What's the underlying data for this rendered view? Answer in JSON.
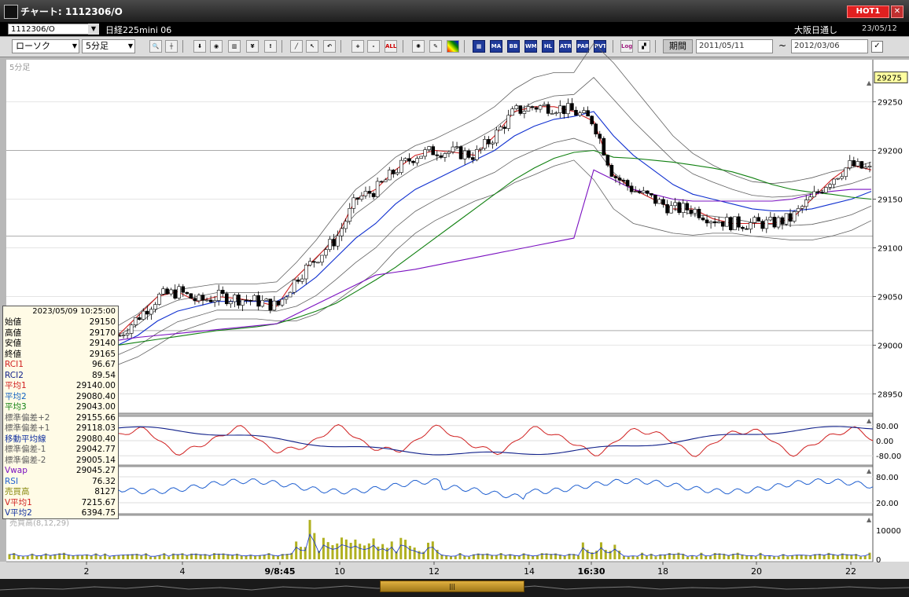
{
  "window": {
    "title": "チャート: 1112306/O",
    "hot_badge": "HOT1",
    "close": "✕"
  },
  "symbol": {
    "code": "1112306/O",
    "name": "日経225mini 06",
    "market": "大阪日通し",
    "date": "23/05/12"
  },
  "toolbar": {
    "chart_type": "ローソク",
    "interval": "5分足",
    "period_label": "期間",
    "date_from": "2011/05/11",
    "date_to": "2012/03/06",
    "tilde": "~",
    "indicator_buttons": [
      "MA",
      "BB",
      "WMA",
      "HL",
      "ATR",
      "PARA",
      "PVT"
    ],
    "log_button": "Log",
    "all_button": "ALL"
  },
  "chart": {
    "interval_label": "5分足",
    "volume_label": "売買高(8,12,29)",
    "current_price_tag": "29275",
    "price_ticks": [
      "29250",
      "29200",
      "29150",
      "29100",
      "29050",
      "29000",
      "28950"
    ],
    "osc_ticks": [
      "80.00",
      "0.00",
      "-80.00"
    ],
    "rsi_ticks": [
      "80.00",
      "20.00"
    ],
    "vol_ticks": [
      "10000",
      "0"
    ],
    "x_labels": [
      {
        "text": "2",
        "bold": false
      },
      {
        "text": "4",
        "bold": false
      },
      {
        "text": "9/8:45",
        "bold": true
      },
      {
        "text": "10",
        "bold": false
      },
      {
        "text": "12",
        "bold": false
      },
      {
        "text": "14",
        "bold": false
      },
      {
        "text": "16:30",
        "bold": true
      },
      {
        "text": "18",
        "bold": false
      },
      {
        "text": "20",
        "bold": false
      },
      {
        "text": "22",
        "bold": false
      }
    ],
    "colors": {
      "candle_up": "#ffffff",
      "candle_down": "#000000",
      "ma1": "#d02020",
      "ma2": "#1030d0",
      "ma3": "#108010",
      "bb": "#606060",
      "vwap": "#7a10c0",
      "rci1": "#d02020",
      "rci2": "#10208a",
      "rsi": "#2060d0",
      "volume": "#b0b020"
    }
  },
  "info_panel": {
    "timestamp": "2023/05/09 10:25:00",
    "rows": [
      {
        "label": "始値",
        "value": "29150",
        "color": "#000000"
      },
      {
        "label": "高値",
        "value": "29170",
        "color": "#000000"
      },
      {
        "label": "安値",
        "value": "29140",
        "color": "#000000"
      },
      {
        "label": "終値",
        "value": "29165",
        "color": "#000000"
      },
      {
        "label": "RCI1",
        "value": "96.67",
        "color": "#d02020"
      },
      {
        "label": "RCI2",
        "value": "89.54",
        "color": "#10208a"
      },
      {
        "label": "平均1",
        "value": "29140.00",
        "color": "#d02020"
      },
      {
        "label": "平均2",
        "value": "29080.40",
        "color": "#1060c0"
      },
      {
        "label": "平均3",
        "value": "29043.00",
        "color": "#108010"
      },
      {
        "label": "標準偏差+2",
        "value": "29155.66",
        "color": "#606060"
      },
      {
        "label": "標準偏差+1",
        "value": "29118.03",
        "color": "#606060"
      },
      {
        "label": "移動平均線",
        "value": "29080.40",
        "color": "#1030a0"
      },
      {
        "label": "標準偏差-1",
        "value": "29042.77",
        "color": "#606060"
      },
      {
        "label": "標準偏差-2",
        "value": "29005.14",
        "color": "#606060"
      },
      {
        "label": "Vwap",
        "value": "29045.27",
        "color": "#7a10c0"
      },
      {
        "label": "RSI",
        "value": "76.32",
        "color": "#2060d0"
      },
      {
        "label": "売買高",
        "value": "8127",
        "color": "#8a8a10"
      },
      {
        "label": "V平均1",
        "value": "7215.67",
        "color": "#d02020"
      },
      {
        "label": "V平均2",
        "value": "6394.75",
        "color": "#1030a0"
      }
    ]
  },
  "chart_data": {
    "type": "line",
    "title": "",
    "y_range": [
      28935,
      29290
    ],
    "series": [
      {
        "name": "平均1",
        "values": [
          29010,
          29030,
          29050,
          29055,
          29045,
          29050,
          29048,
          29045,
          29040,
          29070,
          29090,
          29110,
          29150,
          29160,
          29180,
          29195,
          29200,
          29198,
          29195,
          29215,
          29240,
          29245,
          29245,
          29240,
          29230,
          29175,
          29160,
          29150,
          29140,
          29140,
          29130,
          29125,
          29125,
          29125,
          29130,
          29150,
          29170,
          29185,
          29180
        ]
      },
      {
        "name": "平均2",
        "values": [
          29000,
          29010,
          29025,
          29035,
          29040,
          29045,
          29045,
          29045,
          29045,
          29055,
          29070,
          29090,
          29110,
          29125,
          29145,
          29160,
          29170,
          29180,
          29190,
          29200,
          29215,
          29225,
          29232,
          29235,
          29240,
          29215,
          29195,
          29180,
          29165,
          29155,
          29150,
          29145,
          29140,
          29138,
          29138,
          29140,
          29145,
          29150,
          29158
        ]
      },
      {
        "name": "平均3",
        "values": [
          29000,
          29003,
          29006,
          29009,
          29012,
          29015,
          29017,
          29019,
          29022,
          29028,
          29035,
          29043,
          29055,
          29067,
          29080,
          29095,
          29110,
          29125,
          29140,
          29155,
          29170,
          29182,
          29192,
          29198,
          29200,
          29193,
          29192,
          29190,
          29188,
          29185,
          29182,
          29178,
          29172,
          29165,
          29160,
          29157,
          29155,
          29152,
          29150
        ]
      },
      {
        "name": "Vwap",
        "values": [
          29005,
          29008,
          29010,
          29012,
          29014,
          29016,
          29018,
          29020,
          29022,
          29032,
          29042,
          29052,
          29062,
          29072,
          29075,
          29078,
          29082,
          29086,
          29090,
          29094,
          29098,
          29102,
          29106,
          29110,
          29180,
          29170,
          29160,
          29155,
          29150,
          29148,
          29148,
          29148,
          29148,
          29148,
          29150,
          29155,
          29158,
          29160,
          29160
        ]
      }
    ]
  },
  "scrollbar": {
    "grip": "|||"
  }
}
